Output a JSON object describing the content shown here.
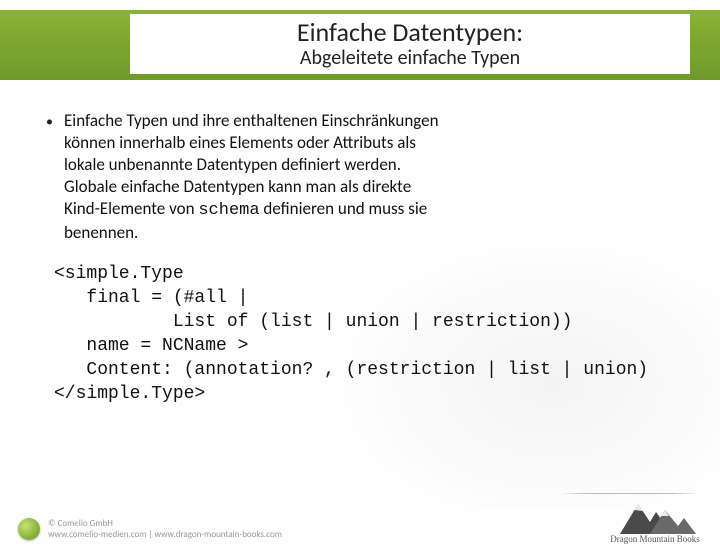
{
  "header": {
    "title": "Einfache Datentypen:",
    "subtitle": "Abgeleitete einfache Typen"
  },
  "content": {
    "bullet_pre": "Einfache Typen und ihre enthaltenen Einschränkungen können innerhalb eines Elements oder Attributs als lokale unbenannte Datentypen definiert werden. Globale einfache Datentypen kann man als direkte Kind-Elemente von ",
    "bullet_code": "schema",
    "bullet_post": " definieren und muss sie benennen."
  },
  "code": {
    "line1": "<simple.Type",
    "line2": "   final = (#all |",
    "line3": "           List of (list | union | restriction))",
    "line4": "   name = NCName >",
    "line5": "   Content: (annotation? , (restriction | list | union)",
    "line6": "</simple.Type>"
  },
  "footer": {
    "copyright": "© Comelio GmbH",
    "url": "www.comelio-medien.com | www.dragon-mountain-books.com",
    "brand": "Dragon Mountain Books"
  }
}
